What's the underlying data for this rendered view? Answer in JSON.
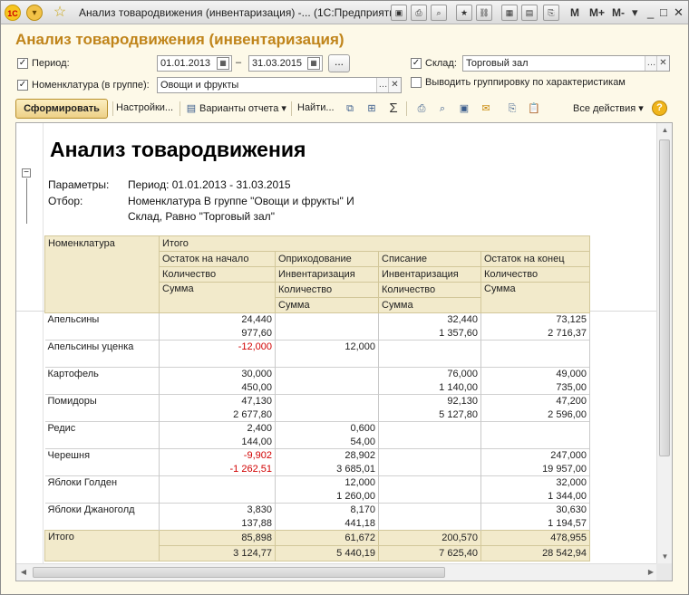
{
  "window": {
    "title": "Анализ товародвижения (инвентаризация) -... (1С:Предприятие)",
    "logo": "1С",
    "toolbar_letters": [
      "M",
      "M+",
      "M-"
    ]
  },
  "form": {
    "title": "Анализ товародвижения (инвентаризация)",
    "period": {
      "label": "Период:",
      "checked": true,
      "from": "01.01.2013",
      "separator": "–",
      "to": "31.03.2015",
      "more_label": "..."
    },
    "warehouse": {
      "label": "Склад:",
      "checked": true,
      "value": "Торговый зал"
    },
    "nomenclature": {
      "label": "Номенклатура (в группе):",
      "checked": true,
      "value": "Овощи и фрукты"
    },
    "group_by_characteristics": {
      "label": "Выводить группировку по характеристикам",
      "checked": false
    }
  },
  "toolbar": {
    "generate": "Сформировать",
    "settings": "Настройки...",
    "variants": "Варианты отчета",
    "find": "Найти...",
    "sigma": "Σ",
    "all_actions": "Все действия",
    "help": "?"
  },
  "report": {
    "title": "Анализ товародвижения",
    "params_label": "Параметры:",
    "params_value": "Период: 01.01.2013 - 31.03.2015",
    "filter_label": "Отбор:",
    "filter_line1": "Номенклатура В группе \"Овощи и фрукты\" И",
    "filter_line2": "Склад, Равно \"Торговый зал\"",
    "headers": {
      "nomenclature": "Номенклатура",
      "total_group": "Итого",
      "opening": "Остаток на начало",
      "receipt": "Оприходование",
      "writeoff": "Списание",
      "closing": "Остаток на конец",
      "quantity": "Количество",
      "inventory": "Инвентаризация",
      "sum": "Сумма"
    },
    "rows": [
      {
        "name": "Апельсины",
        "q": [
          "24,440",
          "",
          "32,440",
          "73,125"
        ],
        "s": [
          "977,60",
          "",
          "1 357,60",
          "2 716,37"
        ],
        "neg_q": [
          false,
          false,
          false,
          false
        ],
        "neg_s": [
          false,
          false,
          false,
          false
        ]
      },
      {
        "name": "Апельсины уценка",
        "q": [
          "-12,000",
          "12,000",
          "",
          ""
        ],
        "s": [
          "",
          "",
          "",
          ""
        ],
        "neg_q": [
          true,
          false,
          false,
          false
        ],
        "neg_s": [
          false,
          false,
          false,
          false
        ]
      },
      {
        "name": "Картофель",
        "q": [
          "30,000",
          "",
          "76,000",
          "49,000"
        ],
        "s": [
          "450,00",
          "",
          "1 140,00",
          "735,00"
        ],
        "neg_q": [
          false,
          false,
          false,
          false
        ],
        "neg_s": [
          false,
          false,
          false,
          false
        ]
      },
      {
        "name": "Помидоры",
        "q": [
          "47,130",
          "",
          "92,130",
          "47,200"
        ],
        "s": [
          "2 677,80",
          "",
          "5 127,80",
          "2 596,00"
        ],
        "neg_q": [
          false,
          false,
          false,
          false
        ],
        "neg_s": [
          false,
          false,
          false,
          false
        ]
      },
      {
        "name": "Редис",
        "q": [
          "2,400",
          "0,600",
          "",
          ""
        ],
        "s": [
          "144,00",
          "54,00",
          "",
          ""
        ],
        "neg_q": [
          false,
          false,
          false,
          false
        ],
        "neg_s": [
          false,
          false,
          false,
          false
        ]
      },
      {
        "name": "Черешня",
        "q": [
          "-9,902",
          "28,902",
          "",
          "247,000"
        ],
        "s": [
          "-1 262,51",
          "3 685,01",
          "",
          "19 957,00"
        ],
        "neg_q": [
          true,
          false,
          false,
          false
        ],
        "neg_s": [
          true,
          false,
          false,
          false
        ]
      },
      {
        "name": "Яблоки Голден",
        "q": [
          "",
          "12,000",
          "",
          "32,000"
        ],
        "s": [
          "",
          "1 260,00",
          "",
          "1 344,00"
        ],
        "neg_q": [
          false,
          false,
          false,
          false
        ],
        "neg_s": [
          false,
          false,
          false,
          false
        ]
      },
      {
        "name": "Яблоки Джаноголд",
        "q": [
          "3,830",
          "8,170",
          "",
          "30,630"
        ],
        "s": [
          "137,88",
          "441,18",
          "",
          "1 194,57"
        ],
        "neg_q": [
          false,
          false,
          false,
          false
        ],
        "neg_s": [
          false,
          false,
          false,
          false
        ]
      }
    ],
    "total": {
      "label": "Итого",
      "q": [
        "85,898",
        "61,672",
        "200,570",
        "478,955"
      ],
      "s": [
        "3 124,77",
        "5 440,19",
        "7 625,40",
        "28 542,94"
      ]
    }
  }
}
